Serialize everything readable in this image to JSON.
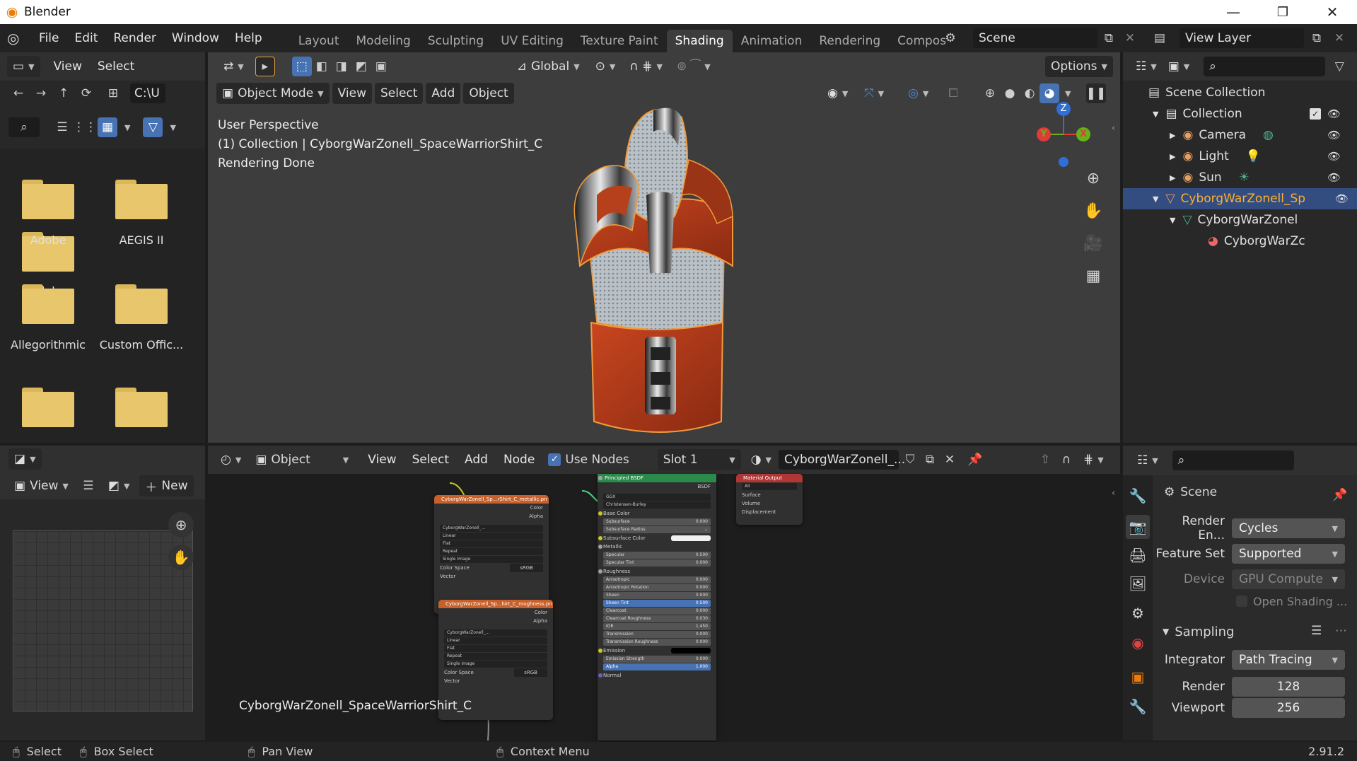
{
  "window": {
    "title": "Blender",
    "minimize": "—",
    "restore": "❐",
    "close": "✕"
  },
  "menu": {
    "items": [
      "File",
      "Edit",
      "Render",
      "Window",
      "Help"
    ]
  },
  "workspaces": {
    "tabs": [
      "Layout",
      "Modeling",
      "Sculpting",
      "UV Editing",
      "Texture Paint",
      "Shading",
      "Animation",
      "Rendering",
      "Compos"
    ],
    "active": "Shading"
  },
  "scene": {
    "name": "Scene"
  },
  "view_layer": {
    "name": "View Layer"
  },
  "file_browser": {
    "menu": [
      "View",
      "Select"
    ],
    "path": "C:\\U",
    "items": [
      {
        "name": "Adobe"
      },
      {
        "name": "AEGIS II"
      },
      {
        "name": "Allegorithmic"
      },
      {
        "name": "Custom Offic..."
      },
      {
        "name": ""
      },
      {
        "name": ""
      }
    ]
  },
  "viewport_toolbar": {
    "orientation": "Global",
    "options": "Options"
  },
  "viewport": {
    "mode": "Object Mode",
    "menus": [
      "View",
      "Select",
      "Add",
      "Object"
    ],
    "overlay_lines": [
      "User Perspective",
      "(1) Collection | CyborgWarZonell_SpaceWarriorShirt_C",
      "Rendering Done"
    ],
    "gizmo": {
      "z": "Z",
      "y": "Y",
      "x": "X"
    }
  },
  "outliner": {
    "rows": [
      {
        "label": "Scene Collection"
      },
      {
        "label": "Collection"
      },
      {
        "label": "Camera"
      },
      {
        "label": "Light"
      },
      {
        "label": "Sun"
      },
      {
        "label": "CyborgWarZonell_Sp"
      },
      {
        "label": "CyborgWarZonel"
      },
      {
        "label": "CyborgWarZc"
      }
    ]
  },
  "image_editor": {
    "view": "View",
    "new": "New"
  },
  "node_editor": {
    "object": "Object",
    "menus": [
      "View",
      "Select",
      "Add",
      "Node"
    ],
    "use_nodes": "Use Nodes",
    "slot": "Slot 1",
    "material": "CyborgWarZonell_...",
    "object_label": "CyborgWarZonell_SpaceWarriorShirt_C",
    "tex1": {
      "title": "CyborgWarZonell_Sp...rShirt_C_metallic.pn",
      "image": "CyborgWarZonell_...",
      "fields": [
        "Linear",
        "Flat",
        "Repeat",
        "Single Image"
      ],
      "color_space": "Color Space",
      "color_space_val": "sRGB",
      "out_color": "Color",
      "out_alpha": "Alpha",
      "vector": "Vector"
    },
    "tex2": {
      "title": "CyborgWarZonell_Sp...hirt_C_roughness.pn",
      "image": "CyborgWarZonell_...",
      "fields": [
        "Linear",
        "Flat",
        "Repeat",
        "Single Image"
      ],
      "color_space": "Color Space",
      "color_space_val": "sRGB",
      "out_color": "Color",
      "out_alpha": "Alpha",
      "vector": "Vector"
    },
    "bsdf": {
      "title": "Principled BSDF",
      "out": "BSDF",
      "dist": "GGX",
      "sss": "Christensen-Burley",
      "rows": [
        {
          "label": "Base Color",
          "val": "",
          "kind": "label"
        },
        {
          "label": "Subsurface",
          "val": "0.000",
          "kind": "slot"
        },
        {
          "label": "Subsurface Radius",
          "val": "",
          "kind": "drop"
        },
        {
          "label": "Subsurface Color",
          "val": "",
          "kind": "color"
        },
        {
          "label": "Metallic",
          "val": "",
          "kind": "label"
        },
        {
          "label": "Specular",
          "val": "0.500",
          "kind": "slot"
        },
        {
          "label": "Specular Tint",
          "val": "0.000",
          "kind": "slot"
        },
        {
          "label": "Roughness",
          "val": "",
          "kind": "label"
        },
        {
          "label": "Anisotropic",
          "val": "0.000",
          "kind": "slot"
        },
        {
          "label": "Anisotropic Rotation",
          "val": "0.000",
          "kind": "slot"
        },
        {
          "label": "Sheen",
          "val": "0.000",
          "kind": "slot"
        },
        {
          "label": "Sheen Tint",
          "val": "0.500",
          "kind": "hl"
        },
        {
          "label": "Clearcoat",
          "val": "0.000",
          "kind": "slot"
        },
        {
          "label": "Clearcoat Roughness",
          "val": "0.030",
          "kind": "slot"
        },
        {
          "label": "IOR",
          "val": "1.450",
          "kind": "slot"
        },
        {
          "label": "Transmission",
          "val": "0.000",
          "kind": "slot"
        },
        {
          "label": "Transmission Roughness",
          "val": "0.000",
          "kind": "slot"
        },
        {
          "label": "Emission",
          "val": "",
          "kind": "black"
        },
        {
          "label": "Emission Strength",
          "val": "0.000",
          "kind": "slot"
        },
        {
          "label": "Alpha",
          "val": "1.000",
          "kind": "hl"
        },
        {
          "label": "Normal",
          "val": "",
          "kind": "label"
        }
      ]
    },
    "output": {
      "title": "Material Output",
      "target": "All",
      "inputs": [
        "Surface",
        "Volume",
        "Displacement"
      ]
    }
  },
  "properties": {
    "context": "Scene",
    "render_engine_label": "Render En...",
    "render_engine": "Cycles",
    "feature_set_label": "Feature Set",
    "feature_set": "Supported",
    "device_label": "Device",
    "device": "GPU Compute",
    "open_shading": "Open Shading ...",
    "sampling": "Sampling",
    "integrator_label": "Integrator",
    "integrator": "Path Tracing",
    "render_label": "Render",
    "render_samples": "128",
    "viewport_label": "Viewport",
    "viewport_samples": "256"
  },
  "statusbar": {
    "select": "Select",
    "box_select": "Box Select",
    "pan_view": "Pan View",
    "context_menu": "Context Menu",
    "version": "2.91.2"
  },
  "colors": {
    "accent": "#4772b3",
    "object_orange": "#e87d0d",
    "node_texture": "#c8602a",
    "node_shader": "#2a8a4a",
    "node_output": "#b33636"
  }
}
